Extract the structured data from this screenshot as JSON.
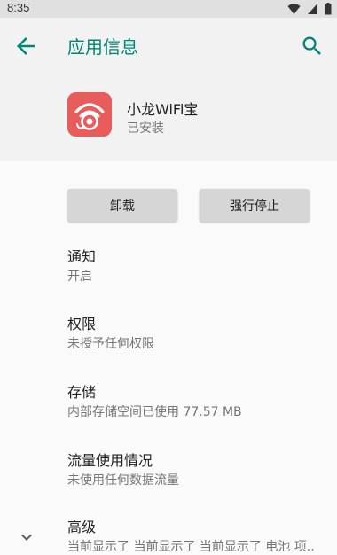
{
  "status_bar": {
    "time": "8:35",
    "icons": [
      "wifi-icon",
      "signal-icon",
      "battery-icon"
    ]
  },
  "app_bar": {
    "title": "应用信息",
    "back_icon": "arrow-back-icon",
    "search_icon": "search-icon",
    "accent_color": "#008577"
  },
  "app": {
    "name": "小龙WiFi宝",
    "status": "已安装",
    "icon_color": "#e85c5c"
  },
  "buttons": {
    "uninstall": "卸载",
    "force_stop": "强行停止"
  },
  "settings": [
    {
      "title": "通知",
      "subtitle": "开启"
    },
    {
      "title": "权限",
      "subtitle": "未授予任何权限"
    },
    {
      "title": "存储",
      "subtitle": "内部存储空间已使用 77.57 MB"
    },
    {
      "title": "流量使用情况",
      "subtitle": "未使用任何数据流量"
    },
    {
      "title": "高级",
      "subtitle": "当前显示了 当前显示了 当前显示了 电池 项.."
    }
  ],
  "expand_icon": "chevron-down-icon"
}
